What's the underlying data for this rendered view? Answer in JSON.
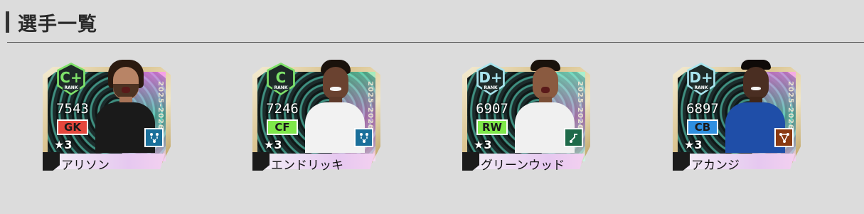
{
  "page": {
    "title": "選手一覧"
  },
  "colors": {
    "rank_c": "#7ee26a",
    "rank_d": "#a8e4ee",
    "pos_gk": "#e5473d",
    "pos_cf": "#7ee84a",
    "pos_rw": "#7ee84a",
    "pos_cb": "#2f8fe0",
    "role_blue": "#1a6f9a",
    "role_green": "#1f6a4a",
    "role_brown": "#8a3a12"
  },
  "players": [
    {
      "rank": "C+",
      "rank_label": "RANK",
      "rating": "7543",
      "position": "GK",
      "stars": "★3",
      "name": "アリソン",
      "season": "2025-2026",
      "role_icon": "tactics-blue-icon"
    },
    {
      "rank": "C",
      "rank_label": "RANK",
      "rating": "7246",
      "position": "CF",
      "stars": "★3",
      "name": "エンドリッキ",
      "season": "2025-2026",
      "role_icon": "tactics-blue-icon"
    },
    {
      "rank": "D+",
      "rank_label": "RANK",
      "rating": "6907",
      "position": "RW",
      "stars": "★3",
      "name": "グリーンウッド",
      "season": "2025-2026",
      "role_icon": "winger-green-icon"
    },
    {
      "rank": "D+",
      "rank_label": "RANK",
      "rating": "6897",
      "position": "CB",
      "stars": "★3",
      "name": "アカンジ",
      "season": "2025-2026",
      "role_icon": "network-orange-icon"
    }
  ]
}
